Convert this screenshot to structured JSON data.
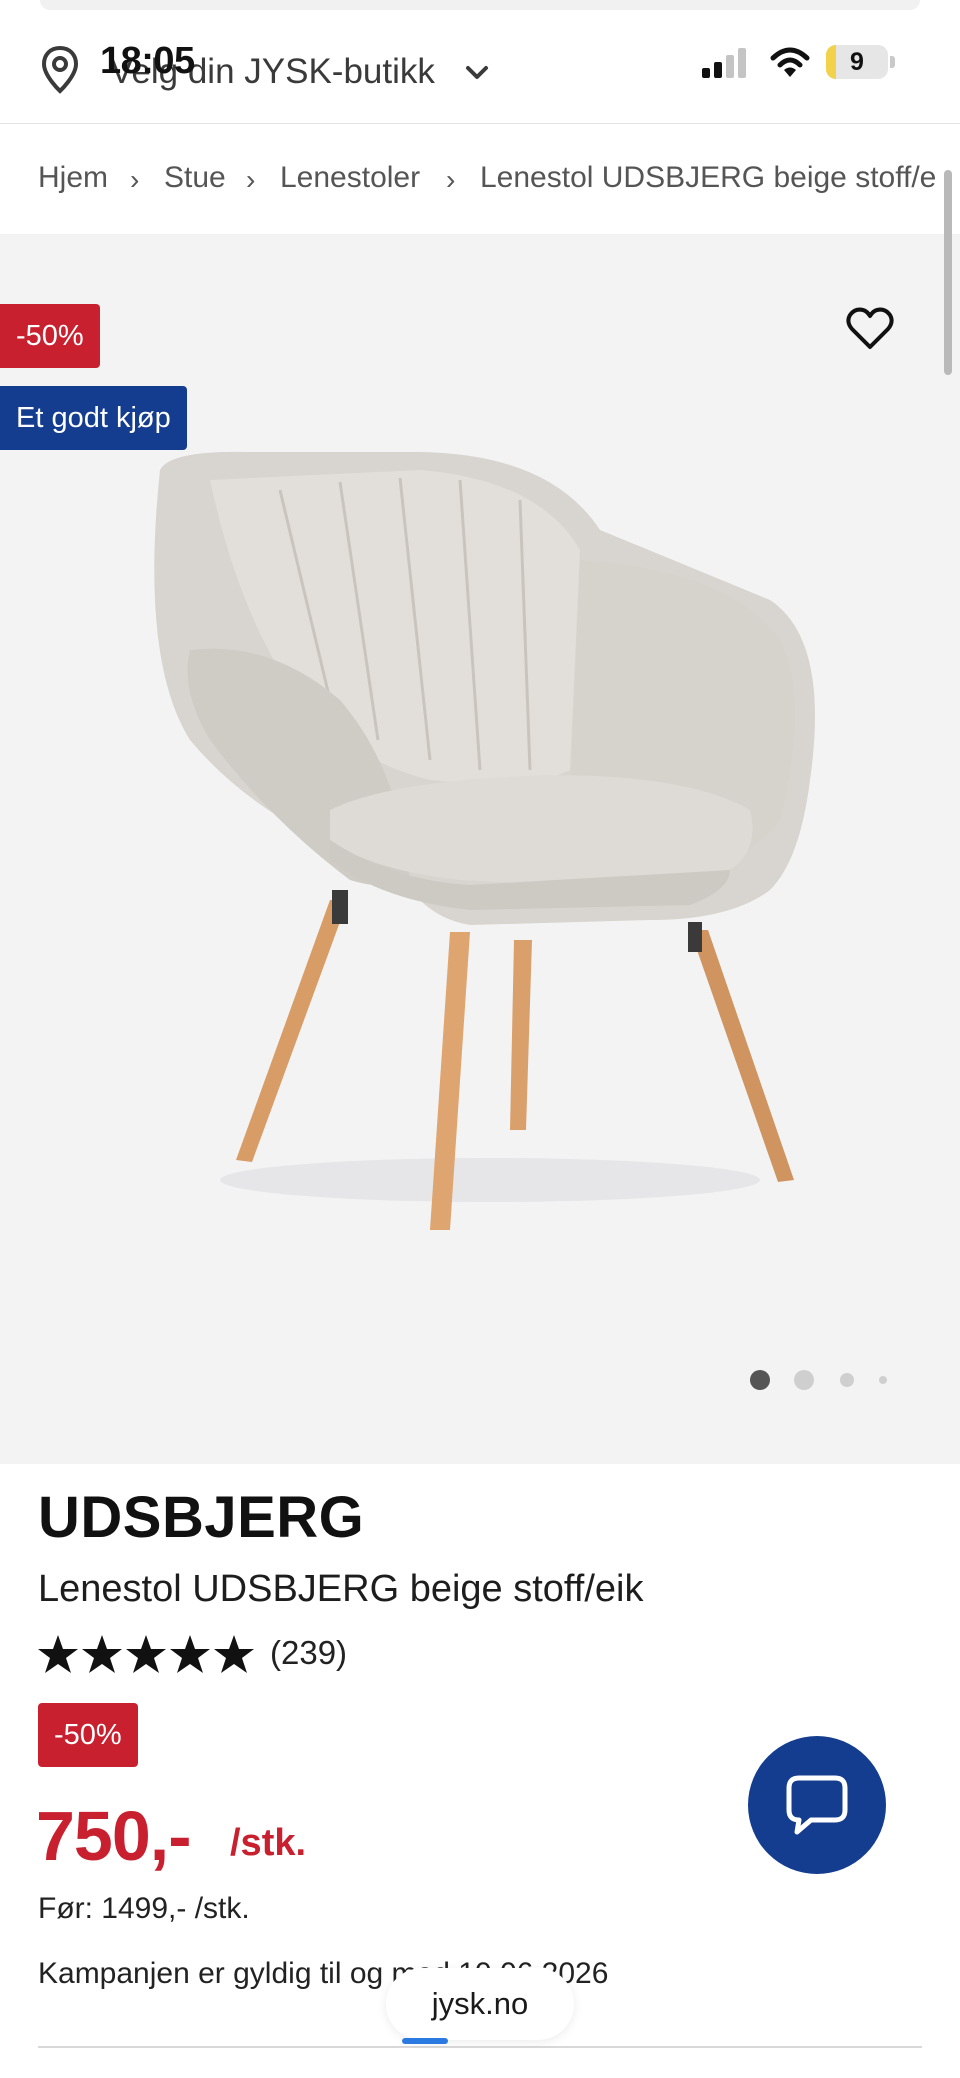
{
  "status_bar": {
    "time": "18:05",
    "battery": "9"
  },
  "store_selector": {
    "label": "Velg din JYSK-butikk"
  },
  "breadcrumb": [
    "Hjem",
    "Stue",
    "Lenestoler",
    "Lenestol UDSBJERG beige stoff/e"
  ],
  "gallery": {
    "badges": [
      "-50%",
      "Et godt kjøp"
    ],
    "slide_count": 4,
    "active_slide": 1
  },
  "product": {
    "brand": "UDSBJERG",
    "name": "Lenestol UDSBJERG beige stoff/eik",
    "rating_stars": 5,
    "review_count": "(239)",
    "discount_badge": "-50%",
    "price": "750,-",
    "unit": "/stk.",
    "before_price": "Før: 1499,- /stk.",
    "campaign_text": "Kampanjen er gyldig til og med 10.06.2026"
  },
  "browser": {
    "url": "jysk.no"
  },
  "colors": {
    "accent_red": "#c8202f",
    "brand_blue": "#143c8f"
  }
}
